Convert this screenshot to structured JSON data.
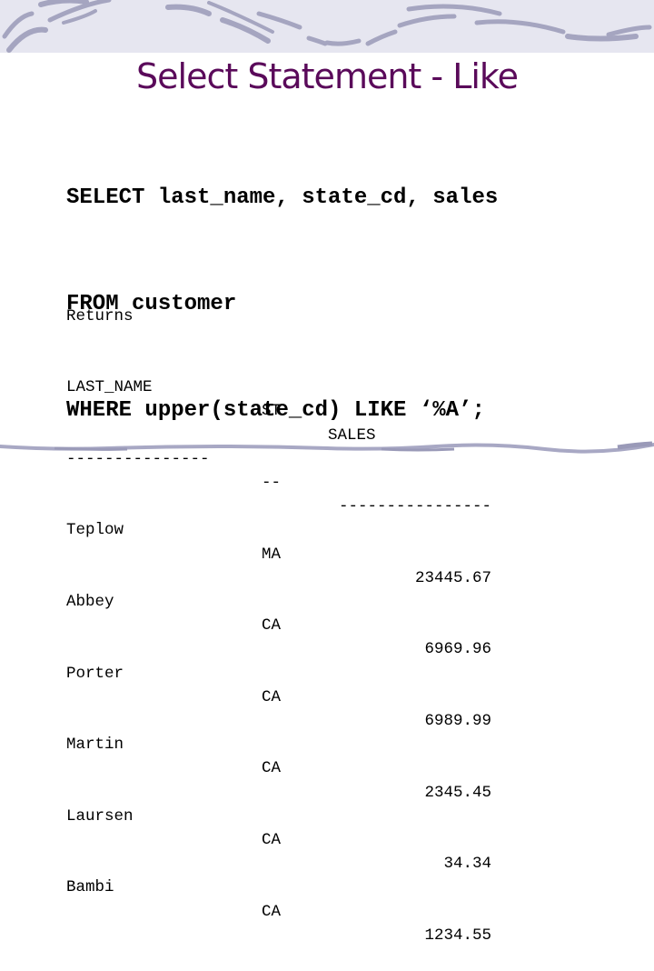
{
  "slide": {
    "title": "Select Statement - Like",
    "sql_lines": [
      "SELECT last_name, state_cd, sales",
      "FROM customer",
      "WHERE upper(state_cd) LIKE ‘%A’;"
    ],
    "result": {
      "label": "Returns",
      "headers": [
        "LAST_NAME",
        "ST",
        "SALES"
      ],
      "separators": [
        "---------------",
        "--",
        "----------------"
      ],
      "rows": [
        [
          "Teplow",
          "MA",
          "23445.67"
        ],
        [
          "Abbey",
          "CA",
          "6969.96"
        ],
        [
          "Porter",
          "CA",
          "6989.99"
        ],
        [
          "Martin",
          "CA",
          "2345.45"
        ],
        [
          "Laursen",
          "CA",
          "34.34"
        ],
        [
          "Bambi",
          "CA",
          "1234.55"
        ]
      ]
    },
    "colors": {
      "title": "#5a0a5a",
      "header_band": "#e6e6f0",
      "swoosh": "#9a9ab8"
    }
  }
}
